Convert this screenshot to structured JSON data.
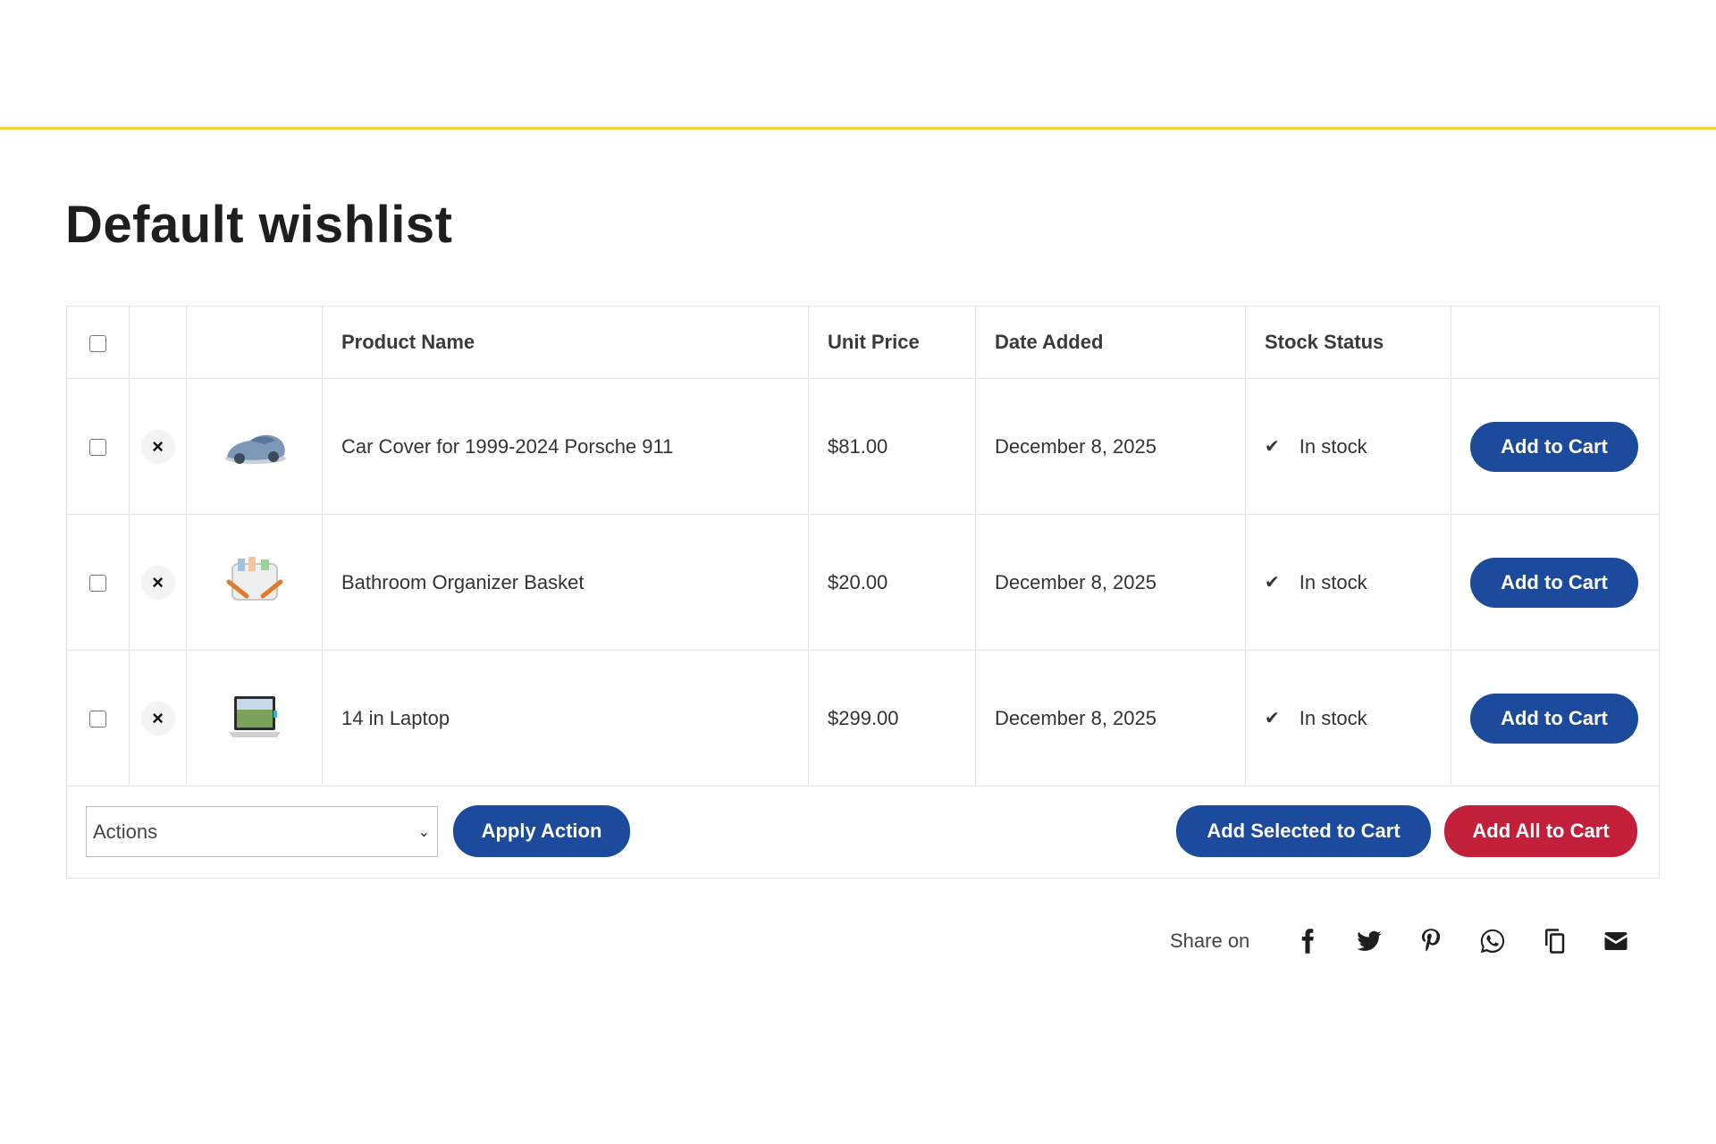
{
  "page": {
    "title": "Default wishlist"
  },
  "colors": {
    "accent_line": "#f5d33b",
    "primary_button": "#1c4a9c",
    "danger_button": "#c2203a"
  },
  "table": {
    "headers": {
      "product_name": "Product Name",
      "unit_price": "Unit Price",
      "date_added": "Date Added",
      "stock_status": "Stock Status"
    },
    "rows": [
      {
        "name": "Car Cover for 1999-2024 Porsche 911",
        "price": "$81.00",
        "date": "December 8, 2025",
        "stock": "In stock",
        "button": "Add to Cart",
        "thumb_icon": "car-cover-image"
      },
      {
        "name": "Bathroom Organizer Basket",
        "price": "$20.00",
        "date": "December 8, 2025",
        "stock": "In stock",
        "button": "Add to Cart",
        "thumb_icon": "organizer-basket-image"
      },
      {
        "name": "14 in Laptop",
        "price": "$299.00",
        "date": "December 8, 2025",
        "stock": "In stock",
        "button": "Add to Cart",
        "thumb_icon": "laptop-image"
      }
    ],
    "remove_symbol": "×",
    "check_symbol": "✔"
  },
  "footer": {
    "actions_select": "Actions",
    "apply_button": "Apply Action",
    "add_selected_button": "Add Selected to Cart",
    "add_all_button": "Add All to Cart"
  },
  "share": {
    "label": "Share on",
    "icons": [
      "facebook-icon",
      "twitter-icon",
      "pinterest-icon",
      "whatsapp-icon",
      "copy-icon",
      "email-icon"
    ]
  }
}
